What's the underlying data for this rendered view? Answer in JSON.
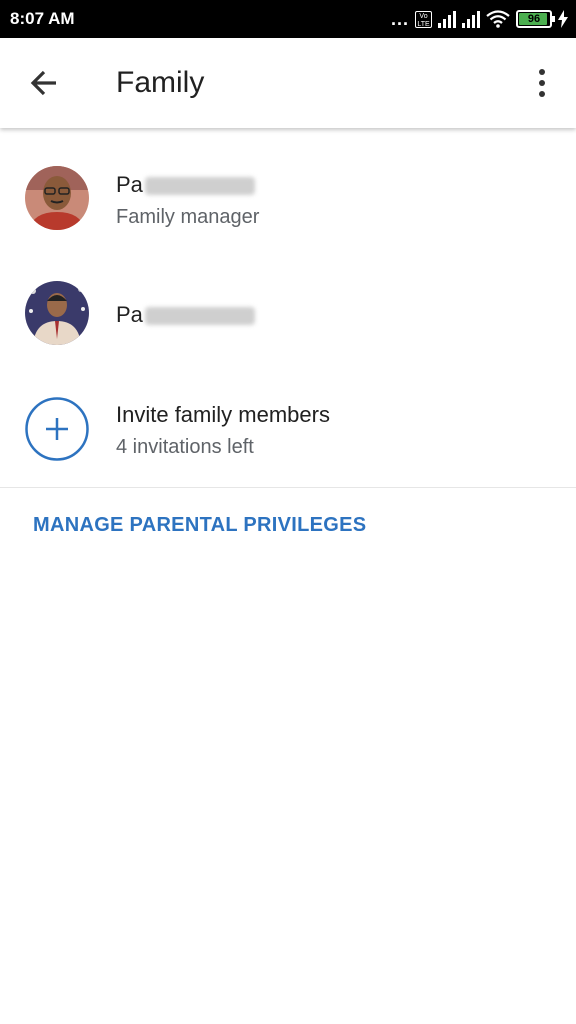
{
  "status_bar": {
    "time": "8:07 AM",
    "overflow_dots": "...",
    "volte_label": "Vo LTE",
    "battery_percent": "96"
  },
  "app_bar": {
    "title": "Family"
  },
  "members": [
    {
      "name_prefix": "Pa",
      "role": "Family manager"
    },
    {
      "name_prefix": "Pa",
      "role": ""
    }
  ],
  "invite": {
    "label": "Invite family members",
    "sub": "4 invitations left"
  },
  "manage_link": "MANAGE PARENTAL PRIVILEGES",
  "colors": {
    "accent": "#2d73c0",
    "battery": "#4caf50",
    "status_bar": "#000000"
  }
}
